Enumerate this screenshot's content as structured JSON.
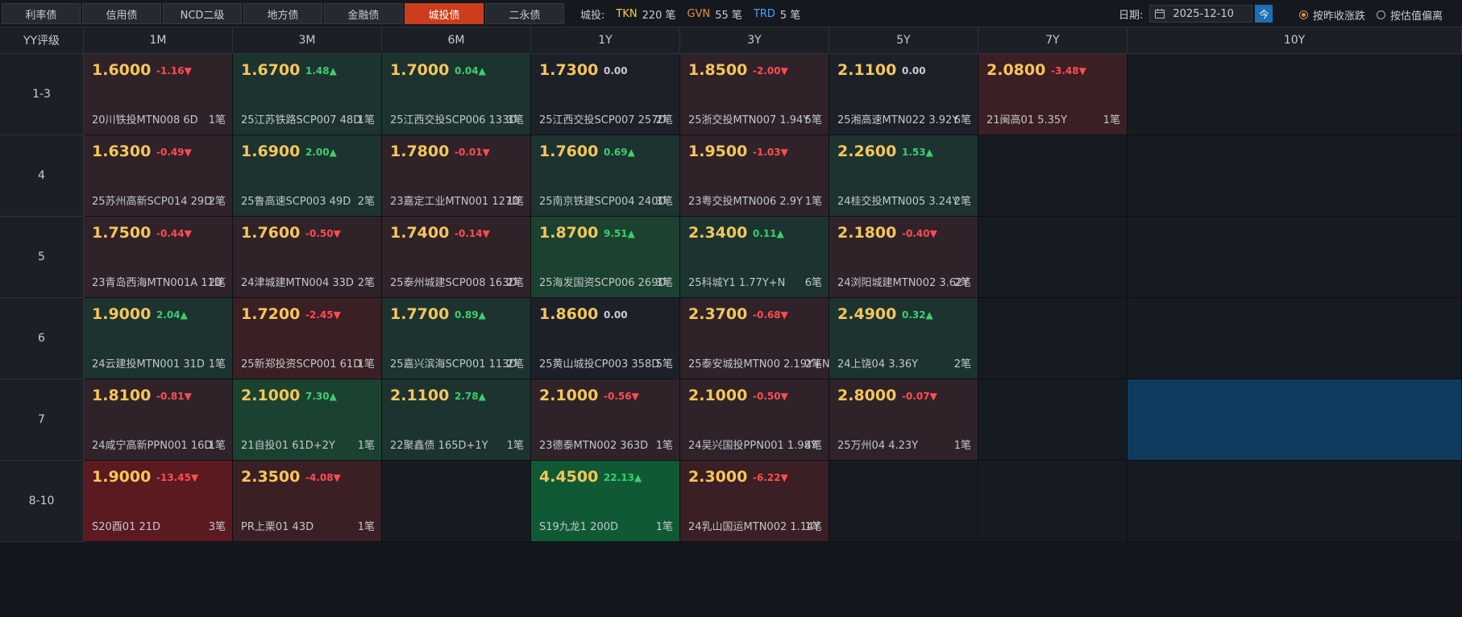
{
  "tabs": [
    {
      "label": "利率债",
      "active": false
    },
    {
      "label": "信用债",
      "active": false
    },
    {
      "label": "NCD二级",
      "active": false
    },
    {
      "label": "地方债",
      "active": false
    },
    {
      "label": "金融债",
      "active": false
    },
    {
      "label": "城投债",
      "active": true
    },
    {
      "label": "二永债",
      "active": false
    }
  ],
  "stats": {
    "category": "城投:",
    "tkn_label": "TKN",
    "tkn_value": "220 笔",
    "gvn_label": "GVN",
    "gvn_value": "55 笔",
    "trd_label": "TRD",
    "trd_value": "5 笔"
  },
  "date": {
    "label": "日期:",
    "value": "2025-12-10",
    "today_label": "今"
  },
  "radios": [
    {
      "label": "按昨收涨跌",
      "checked": true
    },
    {
      "label": "按估值偏离",
      "checked": false
    }
  ],
  "colors": {
    "accent": "#cc3d1d",
    "price": "#f6c65a",
    "up": "#3ccf6a",
    "down": "#ff4d4f",
    "selected": "#0f3b5f"
  },
  "grid": {
    "corner": "YY评级",
    "columns": [
      "1M",
      "3M",
      "6M",
      "1Y",
      "3Y",
      "5Y",
      "7Y",
      "10Y"
    ],
    "rows": [
      {
        "label": "1-3",
        "cells": [
          {
            "price": "1.6000",
            "change": "-1.16▼",
            "dir": "dn",
            "bond": "20川铁投MTN008 6D",
            "count": "1笔",
            "tone": "neg1"
          },
          {
            "price": "1.6700",
            "change": "1.48▲",
            "dir": "up",
            "bond": "25江苏铁路SCP007 48D",
            "count": "1笔",
            "tone": "pos1"
          },
          {
            "price": "1.7000",
            "change": "0.04▲",
            "dir": "up",
            "bond": "25江西交投SCP006 133D",
            "count": "3笔",
            "tone": "pos1"
          },
          {
            "price": "1.7300",
            "change": "0.00",
            "dir": "flat",
            "bond": "25江西交投SCP007 257D",
            "count": "2笔",
            "tone": "zero"
          },
          {
            "price": "1.8500",
            "change": "-2.00▼",
            "dir": "dn",
            "bond": "25浙交投MTN007 1.94Y",
            "count": "5笔",
            "tone": "neg1"
          },
          {
            "price": "2.1100",
            "change": "0.00",
            "dir": "flat",
            "bond": "25湘高速MTN022 3.92Y",
            "count": "6笔",
            "tone": "zero"
          },
          {
            "price": "2.0800",
            "change": "-3.48▼",
            "dir": "dn",
            "bond": "21闽高01 5.35Y",
            "count": "1笔",
            "tone": "neg2"
          },
          null
        ]
      },
      {
        "label": "4",
        "cells": [
          {
            "price": "1.6300",
            "change": "-0.49▼",
            "dir": "dn",
            "bond": "25苏州高新SCP014 29D",
            "count": "2笔",
            "tone": "neg1"
          },
          {
            "price": "1.6900",
            "change": "2.00▲",
            "dir": "up",
            "bond": "25鲁高速SCP003 49D",
            "count": "2笔",
            "tone": "pos1"
          },
          {
            "price": "1.7800",
            "change": "-0.01▼",
            "dir": "dn",
            "bond": "23嘉定工业MTN001 127D",
            "count": "1笔",
            "tone": "neg1"
          },
          {
            "price": "1.7600",
            "change": "0.69▲",
            "dir": "up",
            "bond": "25南京铁建SCP004 240D",
            "count": "3笔",
            "tone": "pos1"
          },
          {
            "price": "1.9500",
            "change": "-1.03▼",
            "dir": "dn",
            "bond": "23粤交投MTN006 2.9Y",
            "count": "1笔",
            "tone": "neg1"
          },
          {
            "price": "2.2600",
            "change": "1.53▲",
            "dir": "up",
            "bond": "24桂交投MTN005 3.24Y",
            "count": "2笔",
            "tone": "pos1"
          },
          null,
          null
        ]
      },
      {
        "label": "5",
        "cells": [
          {
            "price": "1.7500",
            "change": "-0.44▼",
            "dir": "dn",
            "bond": "23青岛西海MTN001A 11D",
            "count": "2笔",
            "tone": "neg1"
          },
          {
            "price": "1.7600",
            "change": "-0.50▼",
            "dir": "dn",
            "bond": "24津城建MTN004 33D",
            "count": "2笔",
            "tone": "neg1"
          },
          {
            "price": "1.7400",
            "change": "-0.14▼",
            "dir": "dn",
            "bond": "25泰州城建SCP008 163D",
            "count": "2笔",
            "tone": "neg1"
          },
          {
            "price": "1.8700",
            "change": "9.51▲",
            "dir": "up",
            "bond": "25海发国资SCP006 269D",
            "count": "3笔",
            "tone": "pos2"
          },
          {
            "price": "2.3400",
            "change": "0.11▲",
            "dir": "up",
            "bond": "25科城Y1 1.77Y+N",
            "count": "6笔",
            "tone": "pos1"
          },
          {
            "price": "2.1800",
            "change": "-0.40▼",
            "dir": "dn",
            "bond": "24浏阳城建MTN002 3.62Y",
            "count": "2笔",
            "tone": "neg1"
          },
          null,
          null
        ]
      },
      {
        "label": "6",
        "cells": [
          {
            "price": "1.9000",
            "change": "2.04▲",
            "dir": "up",
            "bond": "24云建投MTN001 31D",
            "count": "1笔",
            "tone": "pos1"
          },
          {
            "price": "1.7200",
            "change": "-2.45▼",
            "dir": "dn",
            "bond": "25新郑投资SCP001 61D",
            "count": "1笔",
            "tone": "neg2"
          },
          {
            "price": "1.7700",
            "change": "0.89▲",
            "dir": "up",
            "bond": "25嘉兴滨海SCP001 113D",
            "count": "2笔",
            "tone": "pos1"
          },
          {
            "price": "1.8600",
            "change": "0.00",
            "dir": "flat",
            "bond": "25黄山城投CP003 358D",
            "count": "5笔",
            "tone": "zero"
          },
          {
            "price": "2.3700",
            "change": "-0.68▼",
            "dir": "dn",
            "bond": "25泰安城投MTN00 2.19Y+N",
            "count": "2笔",
            "tone": "neg1"
          },
          {
            "price": "2.4900",
            "change": "0.32▲",
            "dir": "up",
            "bond": "24上饶04 3.36Y",
            "count": "2笔",
            "tone": "pos1"
          },
          null,
          null
        ]
      },
      {
        "label": "7",
        "cells": [
          {
            "price": "1.8100",
            "change": "-0.81▼",
            "dir": "dn",
            "bond": "24咸宁高新PPN001 16D",
            "count": "1笔",
            "tone": "neg1"
          },
          {
            "price": "2.1000",
            "change": "7.30▲",
            "dir": "up",
            "bond": "21自投01 61D+2Y",
            "count": "1笔",
            "tone": "pos2"
          },
          {
            "price": "2.1100",
            "change": "2.78▲",
            "dir": "up",
            "bond": "22聚鑫债 165D+1Y",
            "count": "1笔",
            "tone": "pos1"
          },
          {
            "price": "2.1000",
            "change": "-0.56▼",
            "dir": "dn",
            "bond": "23德泰MTN002 363D",
            "count": "1笔",
            "tone": "neg1"
          },
          {
            "price": "2.1000",
            "change": "-0.50▼",
            "dir": "dn",
            "bond": "24吴兴国投PPN001 1.98Y",
            "count": "4笔",
            "tone": "neg1"
          },
          {
            "price": "2.8000",
            "change": "-0.07▼",
            "dir": "dn",
            "bond": "25万州04 4.23Y",
            "count": "1笔",
            "tone": "neg1"
          },
          null,
          "selected"
        ]
      },
      {
        "label": "8-10",
        "cells": [
          {
            "price": "1.9000",
            "change": "-13.45▼",
            "dir": "dn",
            "bond": "S20酉01 21D",
            "count": "3笔",
            "tone": "neg3"
          },
          {
            "price": "2.3500",
            "change": "-4.08▼",
            "dir": "dn",
            "bond": "PR上栗01 43D",
            "count": "1笔",
            "tone": "neg2"
          },
          null,
          {
            "price": "4.4500",
            "change": "22.13▲",
            "dir": "up",
            "bond": "S19九龙1 200D",
            "count": "1笔",
            "tone": "pos3"
          },
          {
            "price": "2.3000",
            "change": "-6.22▼",
            "dir": "dn",
            "bond": "24乳山国运MTN002 1.14Y",
            "count": "1笔",
            "tone": "neg2"
          },
          null,
          null,
          null
        ]
      }
    ]
  }
}
